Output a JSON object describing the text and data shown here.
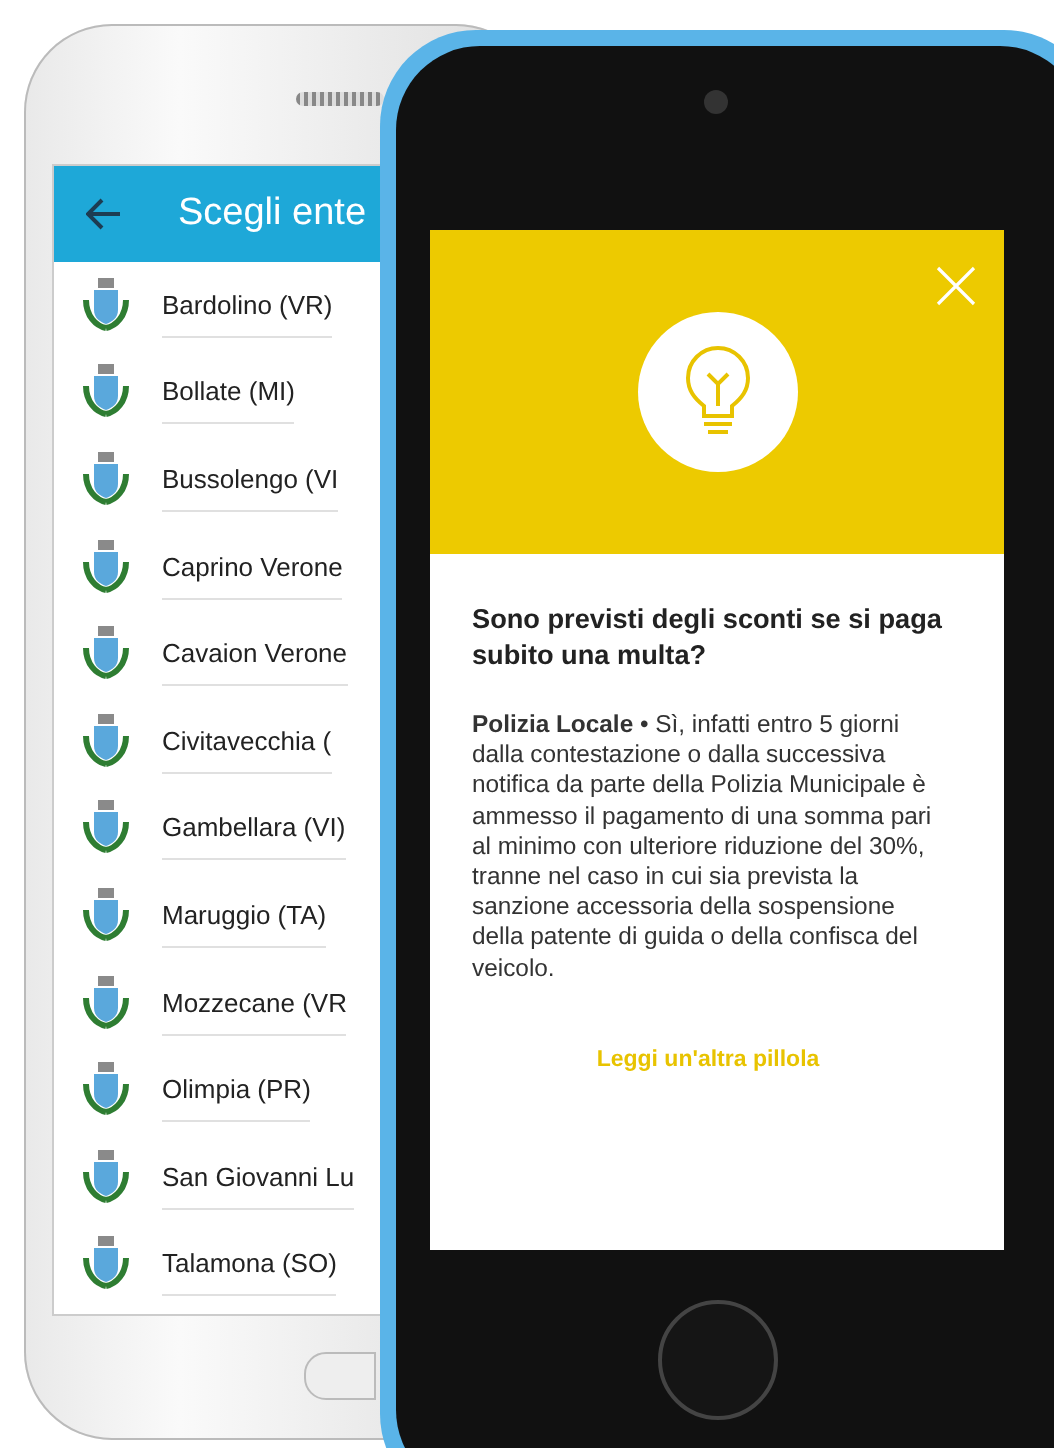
{
  "list_screen": {
    "title": "Scegli ente",
    "items": [
      "Bardolino (VR)",
      "Bollate (MI)",
      "Bussolengo (VI",
      "Caprino Verone",
      "Cavaion Verone",
      "Civitavecchia (",
      "Gambellara (VI)",
      "Maruggio (TA)",
      "Mozzecane (VR",
      "Olimpia (PR)",
      "San Giovanni Lu",
      "Talamona (SO)"
    ]
  },
  "tip_screen": {
    "question": "Sono previsti degli sconti se si paga subito una multa?",
    "answer": "**Polizia Locale** • Sì, infatti entro 5 giorni dalla contestazione o dalla successiva notifica da parte della Polizia Municipale è ammesso il pagamento di una somma pari al minimo con ulteriore riduzione del 30%, tranne nel caso in cui sia prevista la sanzione accessoria della sospensione della patente di guida o della confisca del veicolo.",
    "link": "Leggi un'altra pillola"
  }
}
